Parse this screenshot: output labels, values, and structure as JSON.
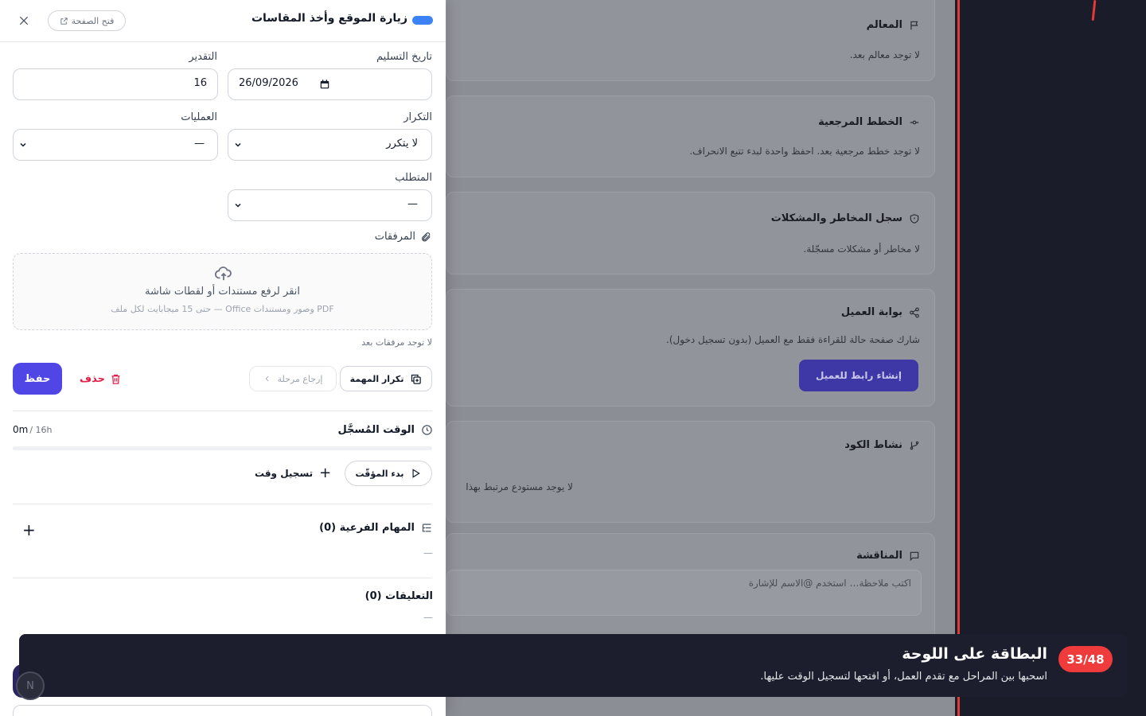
{
  "drawer": {
    "title": "زيارة الموقع وأخذ المقاسات",
    "open_page_label": "فتح الصفحة",
    "fields": {
      "due_date_label": "تاريخ التسليم",
      "due_date_value": "26/09/2026",
      "estimate_label": "التقدير",
      "estimate_value": "16",
      "recurrence_label": "التكرار",
      "recurrence_value": "لا يتكرر",
      "operations_label": "العمليات",
      "operations_value": "—",
      "requirement_label": "المتطلب",
      "requirement_value": "—"
    },
    "attachments": {
      "label": "المرفقات",
      "drop_main": "انقر لرفع مستندات أو لقطات شاشة",
      "drop_sub": "PDF وصور ومستندات Office — حتى 15 ميجابايت لكل ملف",
      "empty": "لا توجد مرفقات بعد"
    },
    "actions": {
      "save": "حفظ",
      "delete": "حذف",
      "revert_stage": "إرجاع مرحلة",
      "duplicate": "تكرار المهمة"
    },
    "time": {
      "heading": "الوقت المُسجَّل",
      "logged": "0m",
      "estimate": "/ 16h",
      "progress_fraction": 0,
      "start_timer": "بدء المؤقّت",
      "log_time": "تسجيل وقت"
    },
    "subtasks": {
      "heading": "المهام الفرعية (0)",
      "empty": "—"
    },
    "comments": {
      "heading": "التعليقات (0)",
      "empty": "—"
    }
  },
  "background": {
    "milestones_title": "المعالم",
    "milestones_empty": "لا توجد معالم بعد.",
    "baselines_title": "الخطط المرجعية",
    "baselines_empty": "لا توجد خطط مرجعية بعد. احفظ واحدة لبدء تتبع الانحراف.",
    "risks_title": "سجل المخاطر والمشكلات",
    "risks_empty": "لا مخاطر أو مشكلات مسجّلة.",
    "portal_title": "بوابة العميل",
    "portal_desc": "شارك صفحة حالة للقراءة فقط مع العميل (بدون تسجيل دخول).",
    "portal_button": "إنشاء رابط للعميل",
    "code_title": "نشاط الكود",
    "code_empty": "لا يوجد مستودع مرتبط بهذا",
    "discussion_title": "المناقشة",
    "discussion_placeholder": "اكتب ملاحظة… استخدم @الاسم للإشارة"
  },
  "tour": {
    "step": "33/48",
    "title": "البطاقة على اللوحة",
    "body": "اسحبها بين المراحل مع تقدم العمل، أو افتحها لتسجيل الوقت عليها."
  },
  "avatar_initial": "N",
  "colors": {
    "primary": "#4f46e5",
    "status_blue": "#3b82f6",
    "danger": "#e11d48",
    "tour_badge": "#ef3b3b",
    "accent_red": "#e53935"
  }
}
